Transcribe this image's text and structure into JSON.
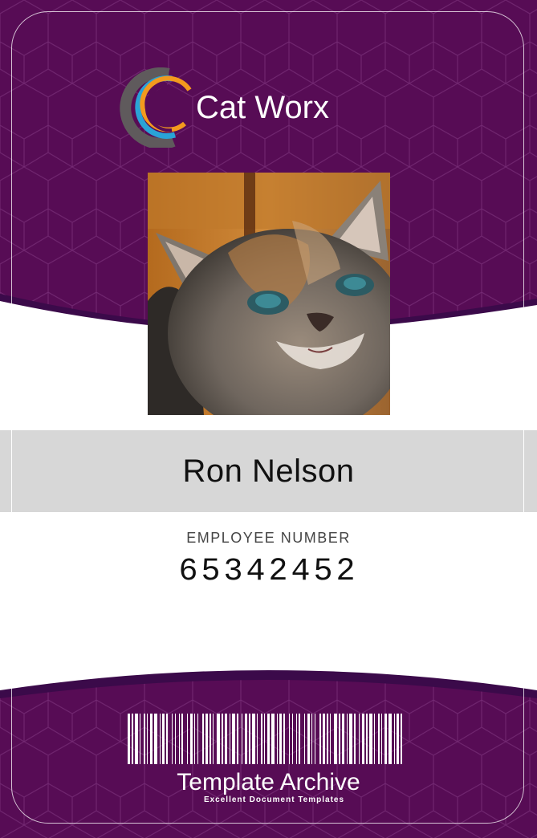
{
  "badge": {
    "company": "Cat Worx",
    "employee_name": "Ron Nelson",
    "employee_number_label": "EMPLOYEE NUMBER",
    "employee_number": "65342452",
    "brand_name": "Template Archive",
    "brand_tagline": "Excellent Document Templates"
  },
  "colors": {
    "band_purple": "#570c55",
    "band_edge": "#3b0a4a",
    "name_bar": "#d7d7d7",
    "logo_orange": "#f39a1e",
    "logo_blue": "#2aa3d6",
    "logo_gray": "#5f5a5c"
  },
  "icons": {
    "logo": "cat-worx-logo-icon",
    "photo": "cat-photo",
    "barcode": "barcode-icon"
  }
}
